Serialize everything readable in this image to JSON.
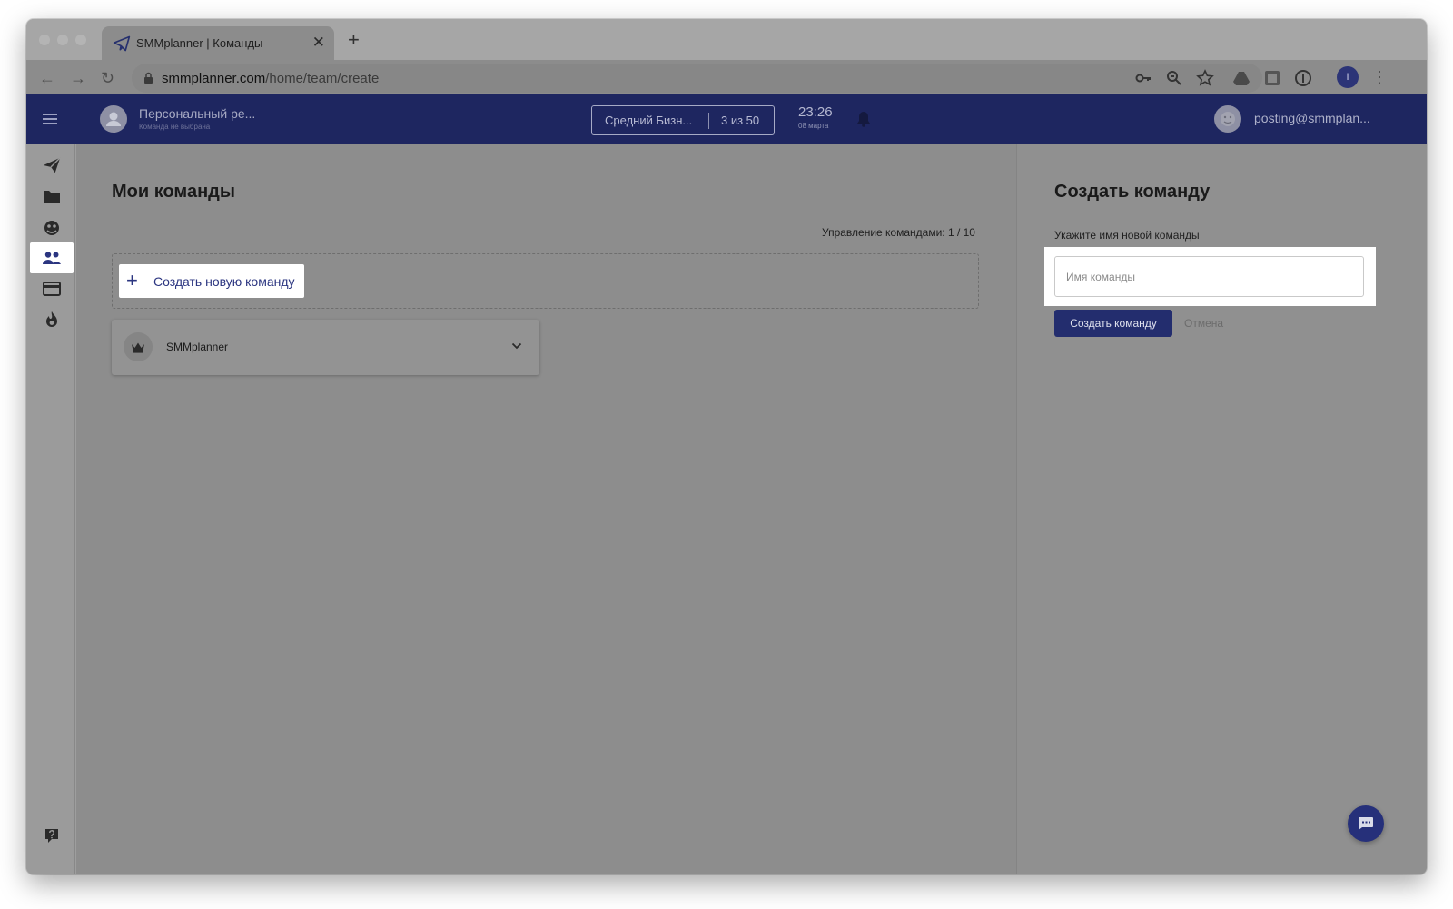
{
  "browser": {
    "tab_title": "SMMplanner | Команды",
    "url_domain": "smmplanner.com",
    "url_path": "/home/team/create",
    "profile_initial": "I"
  },
  "header": {
    "account_name": "Персональный ре...",
    "account_subtitle": "Команда не выбрана",
    "plan_name": "Средний Бизн...",
    "plan_usage": "3 из 50",
    "time": "23:26",
    "date": "08 марта",
    "user_email": "posting@smmplan..."
  },
  "sidebar": {
    "items": [
      {
        "icon": "send-icon"
      },
      {
        "icon": "folder-icon"
      },
      {
        "icon": "social-accounts-icon"
      },
      {
        "icon": "team-icon",
        "active": true
      },
      {
        "icon": "payment-card-icon"
      },
      {
        "icon": "fire-icon"
      }
    ],
    "help_icon": "help-icon"
  },
  "main": {
    "title": "Мои команды",
    "management_counter": "Управление командами: 1 / 10",
    "create_team_label": "Создать новую команду",
    "teams": [
      {
        "name": "SMMplanner",
        "icon": "crown-icon"
      }
    ]
  },
  "create_panel": {
    "title": "Создать команду",
    "field_label": "Укажите имя новой команды",
    "input_placeholder": "Имя команды",
    "input_value": "",
    "submit_label": "Создать команду",
    "cancel_label": "Отмена"
  },
  "colors": {
    "app_header": "#1e2660",
    "primary_button": "#232d6e",
    "accent_text": "#2b3580"
  }
}
